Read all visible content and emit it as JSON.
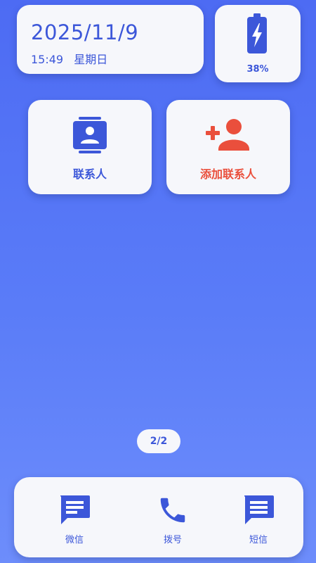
{
  "status": {
    "date": "2025/11/9",
    "time": "15:49",
    "weekday": "星期日",
    "battery_percent": "38%"
  },
  "apps": [
    {
      "label": "联系人",
      "icon": "contacts-icon",
      "color": "#3c57d9"
    },
    {
      "label": "添加联系人",
      "icon": "add-person-icon",
      "color": "#ea4f3c"
    }
  ],
  "page_indicator": "2/2",
  "dock": [
    {
      "label": "微信",
      "icon": "chat-icon"
    },
    {
      "label": "拨号",
      "icon": "phone-icon"
    },
    {
      "label": "短信",
      "icon": "message-icon"
    }
  ],
  "colors": {
    "accent": "#3c57d9",
    "danger": "#ea4f3c",
    "background_top": "#4d6bf3",
    "background_bottom": "#6d8dfb",
    "card": "#f6f7fb"
  }
}
